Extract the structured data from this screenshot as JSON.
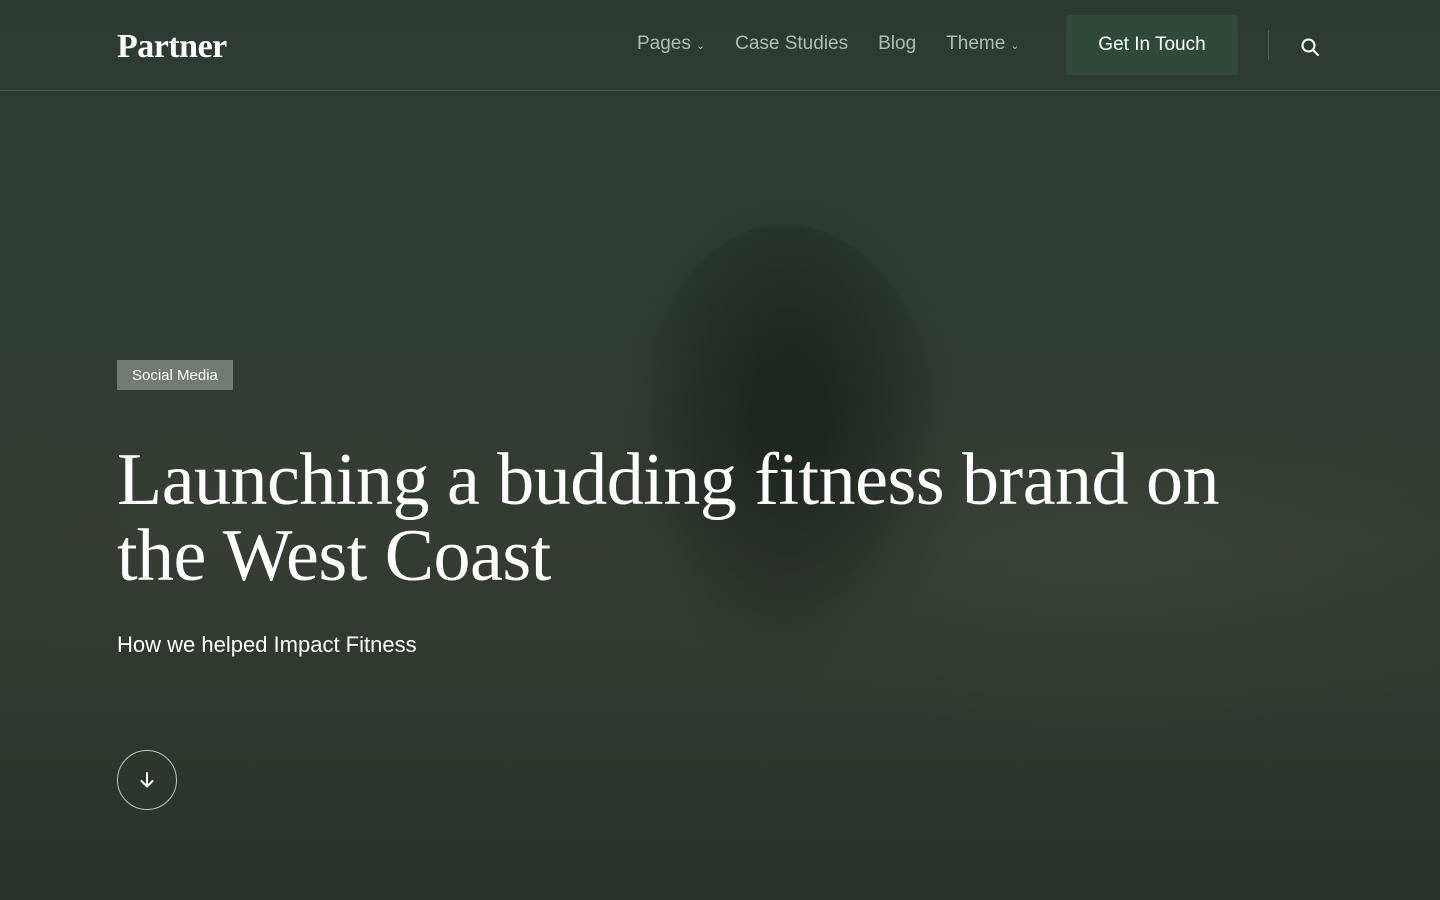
{
  "header": {
    "logo": "Partner",
    "nav": [
      {
        "label": "Pages",
        "has_dropdown": true
      },
      {
        "label": "Case Studies",
        "has_dropdown": false
      },
      {
        "label": "Blog",
        "has_dropdown": false
      },
      {
        "label": "Theme",
        "has_dropdown": true
      }
    ],
    "cta_label": "Get In Touch",
    "search_icon": "search-icon"
  },
  "hero": {
    "category": "Social Media",
    "title": "Launching a budding fitness brand on the West Coast",
    "subtitle": "How we helped Impact Fitness",
    "scroll_icon": "arrow-down-icon"
  },
  "colors": {
    "background": "#2d3a34",
    "cta": "#2f4a3a",
    "nav_text": "#b4bab6",
    "badge": "#8a908c"
  }
}
